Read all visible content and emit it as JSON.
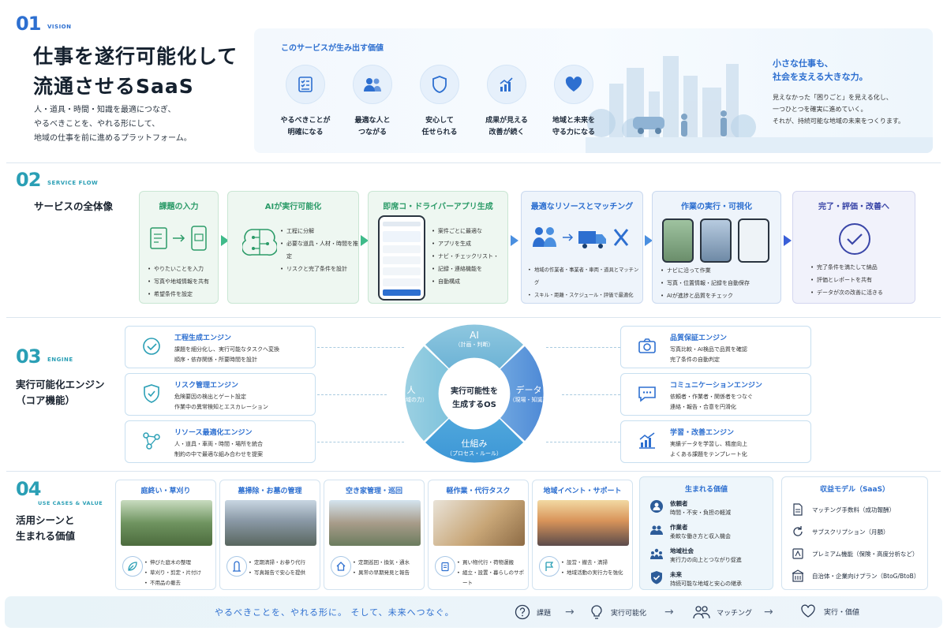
{
  "sections": {
    "s1": {
      "num": "01",
      "label": "VISION",
      "title1": "仕事を遂行可能化して",
      "title2": "流通させるSaaS",
      "desc": [
        "人・道具・時間・知識を最適につなぎ、",
        "やるべきことを、やれる形にして、",
        "地域の仕事を前に進めるプラットフォーム。"
      ]
    },
    "s2": {
      "num": "02",
      "label": "SERVICE FLOW",
      "title": "サービスの全体像"
    },
    "s3": {
      "num": "03",
      "label": "ENGINE",
      "title1": "実行可能化エンジン",
      "title2": "（コア機能）"
    },
    "s4": {
      "num": "04",
      "label": "USE CASES & VALUE",
      "title1": "活用シーンと",
      "title2": "生まれる価値"
    }
  },
  "vision": {
    "heading": "このサービスが生み出す価値",
    "items": [
      {
        "icon": "checklist-icon",
        "l1": "やるべきことが",
        "l2": "明確になる"
      },
      {
        "icon": "people-icon",
        "l1": "最適な人と",
        "l2": "つながる"
      },
      {
        "icon": "shield-icon",
        "l1": "安心して",
        "l2": "任せられる"
      },
      {
        "icon": "growth-chart-icon",
        "l1": "成果が見える",
        "l2": "改善が続く"
      },
      {
        "icon": "heart-icon",
        "l1": "地域と未来を",
        "l2": "守る力になる"
      }
    ],
    "right_h1": "小さな仕事も、",
    "right_h2": "社会を支える大きな力。",
    "right_p": [
      "見えなかった「困りごと」を見える化し、",
      "一つひとつを確実に進めていく。",
      "それが、持続可能な地域の未来をつくります。"
    ]
  },
  "flow": [
    {
      "title": "課題の入力",
      "bullets": [
        "やりたいことを入力",
        "写真や地域情報を共有",
        "希望条件を設定"
      ]
    },
    {
      "title": "AIが実行可能化",
      "bullets": [
        "工程に分解",
        "必要な道具・人材・時間を推定",
        "リスクと完了条件を設計"
      ]
    },
    {
      "title": "即席コ・ドライバーアプリ生成",
      "bullets": [
        "案件ごとに最適な",
        "アプリを生成",
        "ナビ・チェックリスト・",
        "記録・連絡機能を",
        "自動構成"
      ]
    },
    {
      "title": "最適なリソースとマッチング",
      "bullets": [
        "地域の作業者・事業者・車両・道具とマッチング",
        "スキル・距離・スケジュール・評価で最適化"
      ]
    },
    {
      "title": "作業の実行・可視化",
      "bullets": [
        "ナビに沿って作業",
        "写真・位置情報・記録を自動保存",
        "AIが進捗と品質をチェック"
      ]
    },
    {
      "title": "完了・評価・改善へ",
      "bullets": [
        "完了条件を満たして納品",
        "評価とレポートを共有",
        "データが次の改善に活きる"
      ]
    }
  ],
  "engine": {
    "center1": "実行可能性を",
    "center2": "生成するOS",
    "seg_top": "AI",
    "seg_top_sub": "（計画・判断）",
    "seg_right": "データ",
    "seg_right_sub": "（現場・知識）",
    "seg_bottom": "仕組み",
    "seg_bottom_sub": "（プロセス・ルール）",
    "seg_left": "人",
    "seg_left_sub": "（地域の力）",
    "left": [
      {
        "title": "工程生成エンジン",
        "b": [
          "課題を細分化し、実行可能なタスクへ変換",
          "順序・依存関係・所要時間を設計"
        ]
      },
      {
        "title": "リスク管理エンジン",
        "b": [
          "危険要因の検出とゲート設定",
          "作業中の異常検知とエスカレーション"
        ]
      },
      {
        "title": "リソース最適化エンジン",
        "b": [
          "人・道具・車両・時間・場所を統合",
          "制約の中で最適な組み合わせを提案"
        ]
      }
    ],
    "right": [
      {
        "title": "品質保証エンジン",
        "b": [
          "写真比較・AI検品で品質を確認",
          "完了条件の自動判定"
        ]
      },
      {
        "title": "コミュニケーションエンジン",
        "b": [
          "依頼者・作業者・関係者をつなぐ",
          "連絡・報告・合意を円滑化"
        ]
      },
      {
        "title": "学習・改善エンジン",
        "b": [
          "実績データを学習し、精度向上",
          "よくある課題をテンプレート化"
        ]
      }
    ]
  },
  "usecases": [
    {
      "title": "庭終い・草刈り",
      "b": [
        "伸びた庭木の整理",
        "草刈り・剪定・片付け",
        "不用品の撤去"
      ]
    },
    {
      "title": "墓掃除・お墓の管理",
      "b": [
        "定期清掃・お参り代行",
        "写真報告で安心を提供"
      ]
    },
    {
      "title": "空き家管理・巡回",
      "b": [
        "定期巡回・換気・通水",
        "異常の早期発見と報告"
      ]
    },
    {
      "title": "軽作業・代行タスク",
      "b": [
        "買い物代行・荷物運搬",
        "組立・設置・暮らしのサポート"
      ]
    },
    {
      "title": "地域イベント・サポート",
      "b": [
        "設営・撤去・清掃",
        "地域活動の実行力を強化"
      ]
    }
  ],
  "value": {
    "title": "生まれる価値",
    "rows": [
      {
        "t": "依頼者",
        "d": "時間・不安・負担の軽減"
      },
      {
        "t": "作業者",
        "d": "柔軟な働き方と収入機会"
      },
      {
        "t": "地域社会",
        "d": "実行力の向上とつながり促進"
      },
      {
        "t": "未来",
        "d": "持続可能な地域と安心の継承"
      }
    ]
  },
  "revenue": {
    "title": "収益モデル（SaaS）",
    "rows": [
      "マッチング手数料（成功報酬）",
      "サブスクリプション（月額）",
      "プレミアム機能（保険・高度分析など）",
      "自治体・企業向けプラン（BtoG/BtoB）"
    ]
  },
  "footer": {
    "text": "やるべきことを、やれる形に。 そして、未来へつなぐ。",
    "steps": [
      "課題",
      "実行可能化",
      "マッチング",
      "実行・価値"
    ]
  }
}
